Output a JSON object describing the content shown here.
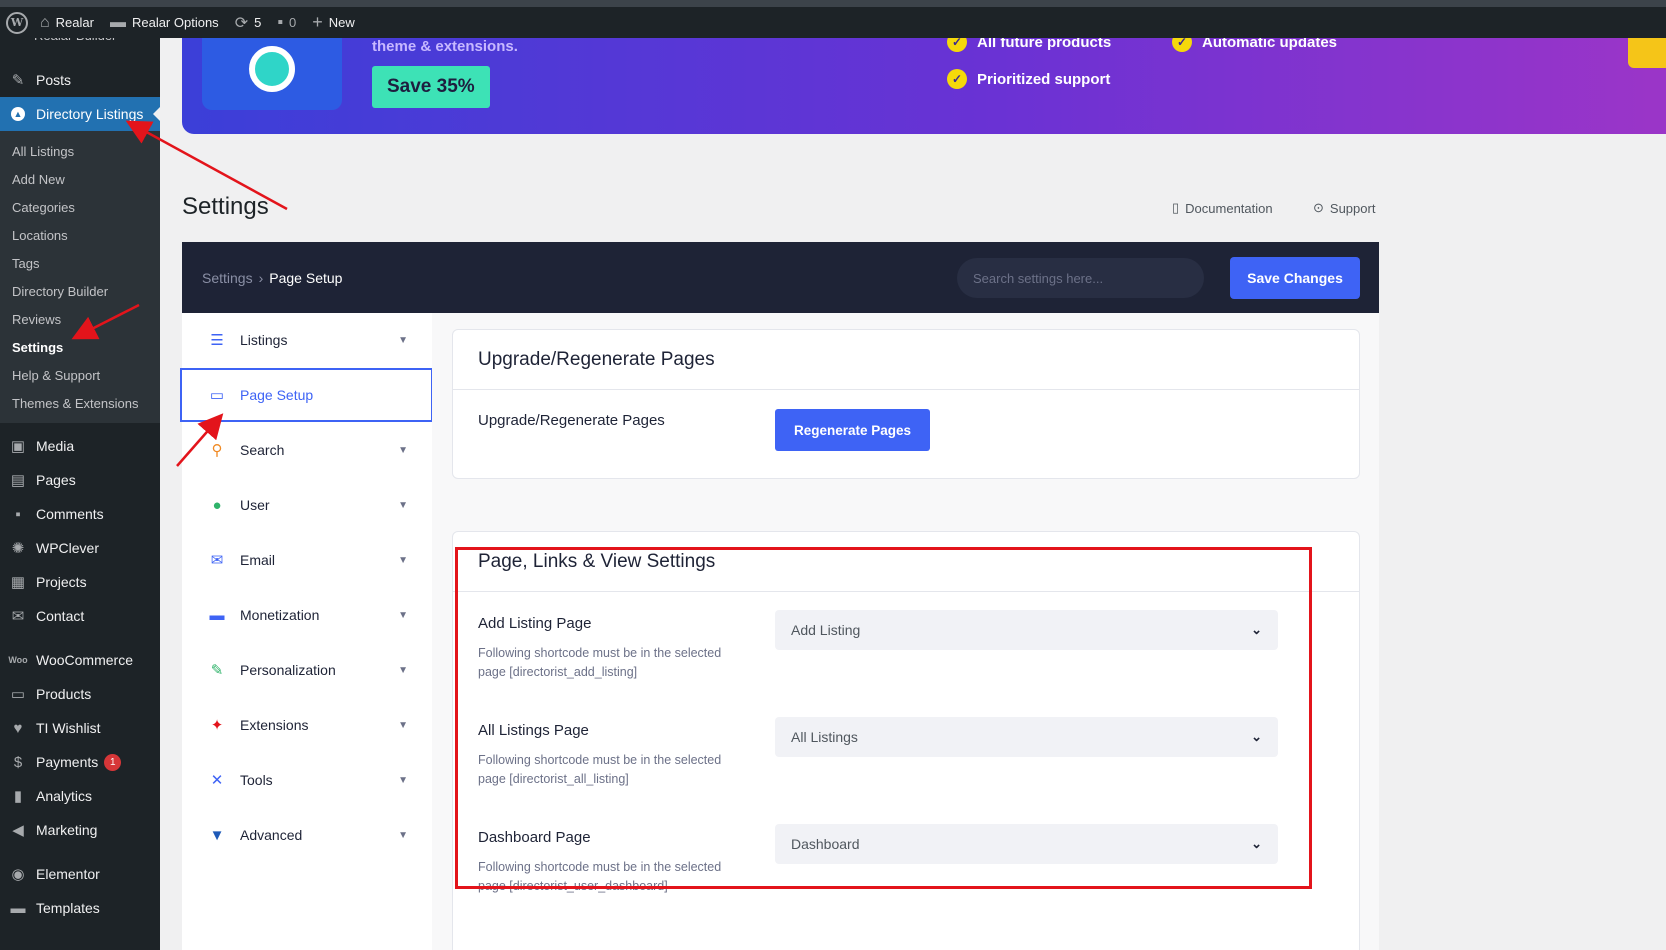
{
  "adminbar": {
    "site_name": "Realar",
    "realar_options": "Realar Options",
    "updates_count": "5",
    "comments_count": "0",
    "new_label": "New"
  },
  "sidebar": {
    "partial_label": "Realar Builder",
    "items_top": [
      {
        "label": "Posts",
        "icon": "pin-icon"
      }
    ],
    "active_item": {
      "label": "Directory Listings",
      "icon": "directory-icon"
    },
    "submenu": [
      {
        "label": "All Listings"
      },
      {
        "label": "Add New"
      },
      {
        "label": "Categories"
      },
      {
        "label": "Locations"
      },
      {
        "label": "Tags"
      },
      {
        "label": "Directory Builder"
      },
      {
        "label": "Reviews"
      },
      {
        "label": "Settings"
      },
      {
        "label": "Help & Support"
      },
      {
        "label": "Themes & Extensions"
      }
    ],
    "items_group1": [
      {
        "label": "Media"
      },
      {
        "label": "Pages"
      },
      {
        "label": "Comments"
      },
      {
        "label": "WPClever"
      },
      {
        "label": "Projects"
      },
      {
        "label": "Contact"
      }
    ],
    "items_group2": [
      {
        "label": "WooCommerce"
      },
      {
        "label": "Products"
      },
      {
        "label": "TI Wishlist"
      },
      {
        "label": "Payments",
        "badge": "1"
      },
      {
        "label": "Analytics"
      },
      {
        "label": "Marketing"
      }
    ],
    "items_group3": [
      {
        "label": "Elementor"
      },
      {
        "label": "Templates"
      }
    ]
  },
  "banner": {
    "partial_text": "theme & extensions.",
    "save_label": "Save 35%",
    "features": [
      "All future products",
      "Automatic updates",
      "Prioritized support"
    ],
    "gradient_start": "#3b3fd8",
    "gradient_end": "#9b35c8"
  },
  "page": {
    "title": "Settings",
    "documentation": "Documentation",
    "support": "Support"
  },
  "header": {
    "breadcrumb_root": "Settings",
    "breadcrumb_current": "Page Setup",
    "search_placeholder": "Search settings here...",
    "save_label": "Save Changes"
  },
  "nav": [
    {
      "label": "Listings",
      "icon": "list-icon",
      "color": "#3e63f5"
    },
    {
      "label": "Page Setup",
      "icon": "monitor-icon",
      "color": "#3e63f5",
      "active": true
    },
    {
      "label": "Search",
      "icon": "search-icon",
      "color": "#f08a24"
    },
    {
      "label": "User",
      "icon": "users-icon",
      "color": "#2fb36a"
    },
    {
      "label": "Email",
      "icon": "mail-icon",
      "color": "#3e63f5"
    },
    {
      "label": "Monetization",
      "icon": "card-icon",
      "color": "#3e63f5"
    },
    {
      "label": "Personalization",
      "icon": "brush-icon",
      "color": "#2fb36a"
    },
    {
      "label": "Extensions",
      "icon": "wand-icon",
      "color": "#e3141b"
    },
    {
      "label": "Tools",
      "icon": "tools-icon",
      "color": "#3e63f5"
    },
    {
      "label": "Advanced",
      "icon": "filter-icon",
      "color": "#1e5ab8"
    }
  ],
  "regen_card": {
    "title": "Upgrade/Regenerate Pages",
    "field_label": "Upgrade/Regenerate Pages",
    "button_label": "Regenerate Pages"
  },
  "links_card": {
    "title": "Page, Links & View Settings",
    "fields": [
      {
        "label": "Add Listing Page",
        "help": "Following shortcode must be in the selected page [directorist_add_listing]",
        "value": "Add Listing"
      },
      {
        "label": "All Listings Page",
        "help": "Following shortcode must be in the selected page [directorist_all_listing]",
        "value": "All Listings"
      },
      {
        "label": "Dashboard Page",
        "help": "Following shortcode must be in the selected page [directorist_user_dashboard]",
        "value": "Dashboard"
      }
    ]
  },
  "colors": {
    "accent": "#3e63f5",
    "annotation": "#e3141b",
    "admin_dark": "#1d2327"
  }
}
